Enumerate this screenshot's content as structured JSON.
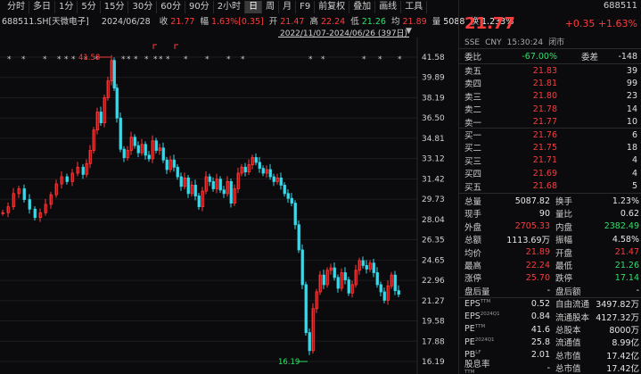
{
  "toolbar": [
    "分时",
    "多日",
    "1分",
    "5分",
    "15分",
    "30分",
    "60分",
    "90分",
    "2小时",
    "日",
    "周",
    "月",
    "F9",
    "前复权",
    "叠加",
    "画线",
    "工具"
  ],
  "toolbar_active": 9,
  "info": {
    "code_name": "688511.SH[天微电子]",
    "date": "2024/06/28",
    "close_label": "收",
    "close": "21.77",
    "amp_label": "幅",
    "amp": "1.63%[0.35]",
    "open_label": "开",
    "open": "21.47",
    "high_label": "高",
    "high": "22.24",
    "low_label": "低",
    "low": "21.26",
    "avg_label": "均",
    "avg": "21.89",
    "vol_label": "量",
    "vol": "5088",
    "turn_label": "换",
    "turn": "1.233%"
  },
  "range_text": "2022/11/07-2024/06/26 (397日)",
  "chart_data": {
    "type": "candlestick",
    "y_ticks": [
      "41.58",
      "39.89",
      "38.19",
      "36.50",
      "34.81",
      "33.12",
      "31.42",
      "29.73",
      "28.04",
      "26.35",
      "24.65",
      "22.96",
      "21.27",
      "19.58",
      "17.88",
      "16.19"
    ],
    "ylim": [
      16.19,
      41.58
    ],
    "annotations": [
      {
        "text": "41.58",
        "value": 41.58
      },
      {
        "text": "16.19",
        "value": 16.19
      }
    ],
    "colors": {
      "up": "#ff3b3b",
      "down": "#3ed6e6"
    }
  },
  "quote": {
    "code": "688511",
    "price": "21.77",
    "change": "+0.35",
    "change_pct": "+1.63%",
    "market": [
      "SSE",
      "CNY",
      "15:30:24",
      "闭市"
    ],
    "weibi_label": "委比",
    "weibi": "-67.00%",
    "weicha_label": "委差",
    "weicha": "-148"
  },
  "asks": [
    {
      "label": "卖五",
      "price": "21.83",
      "vol": "39"
    },
    {
      "label": "卖四",
      "price": "21.81",
      "vol": "99"
    },
    {
      "label": "卖三",
      "price": "21.80",
      "vol": "23"
    },
    {
      "label": "卖二",
      "price": "21.78",
      "vol": "14"
    },
    {
      "label": "卖一",
      "price": "21.77",
      "vol": "10"
    }
  ],
  "bids": [
    {
      "label": "买一",
      "price": "21.76",
      "vol": "6"
    },
    {
      "label": "买二",
      "price": "21.75",
      "vol": "18"
    },
    {
      "label": "买三",
      "price": "21.71",
      "vol": "4"
    },
    {
      "label": "买四",
      "price": "21.69",
      "vol": "4"
    },
    {
      "label": "买五",
      "price": "21.68",
      "vol": "5"
    }
  ],
  "stats": [
    {
      "k1": "总量",
      "v1": "5087.82",
      "k2": "换手",
      "v2": "1.23%",
      "c1": "white",
      "c2": "white"
    },
    {
      "k1": "现手",
      "v1": "90",
      "k2": "量比",
      "v2": "0.62",
      "c1": "white",
      "c2": "white"
    },
    {
      "k1": "外盘",
      "v1": "2705.33",
      "k2": "内盘",
      "v2": "2382.49",
      "c1": "red",
      "c2": "green"
    },
    {
      "k1": "总额",
      "v1": "1113.69万",
      "k2": "振幅",
      "v2": "4.58%",
      "c1": "white",
      "c2": "white"
    },
    {
      "k1": "均价",
      "v1": "21.89",
      "k2": "开盘",
      "v2": "21.47",
      "c1": "red",
      "c2": "red"
    },
    {
      "k1": "最高",
      "v1": "22.24",
      "k2": "最低",
      "v2": "21.26",
      "c1": "red",
      "c2": "green"
    },
    {
      "k1": "涨停",
      "v1": "25.70",
      "k2": "跌停",
      "v2": "17.14",
      "c1": "red",
      "c2": "green"
    },
    {
      "k1": "盘后量",
      "v1": "-",
      "k2": "盘后额",
      "v2": "-",
      "c1": "white",
      "c2": "white"
    },
    {
      "k1": "EPS",
      "sup1": "TTM",
      "v1": "0.52",
      "k2": "自由流通",
      "v2": "3497.82万",
      "c1": "white",
      "c2": "white"
    },
    {
      "k1": "EPS",
      "sup1": "2024Q1",
      "v1": "0.84",
      "k2": "流通股本",
      "v2": "4127.32万",
      "c1": "white",
      "c2": "white"
    },
    {
      "k1": "PE",
      "sup1": "TTM",
      "v1": "41.6",
      "k2": "总股本",
      "v2": "8000万",
      "c1": "white",
      "c2": "white"
    },
    {
      "k1": "PE",
      "sup1": "2024Q1",
      "v1": "25.8",
      "k2": "流通值",
      "v2": "8.99亿",
      "c1": "white",
      "c2": "white"
    },
    {
      "k1": "PB",
      "sup1": "LF",
      "v1": "2.01",
      "k2": "总市值",
      "v2": "17.42亿",
      "c1": "white",
      "c2": "white"
    },
    {
      "k1": "股息率",
      "sup1": "TTM",
      "v1": "-",
      "k2": "总市值",
      "v2": "17.42亿",
      "c1": "white",
      "c2": "white"
    }
  ]
}
